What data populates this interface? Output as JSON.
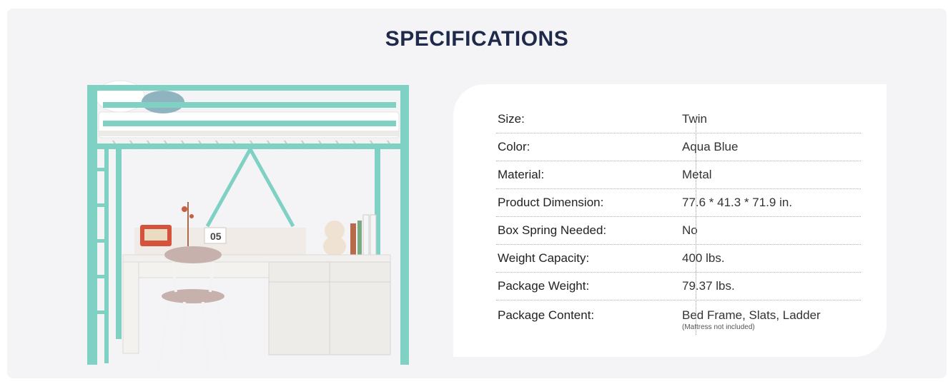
{
  "section": {
    "title": "SPECIFICATIONS"
  },
  "product_image": {
    "icon": "loft-bed-with-desk-illustration",
    "frame_color": "#7fd1c3",
    "calendar_text": "05"
  },
  "specs": [
    {
      "label": "Size:",
      "value": "Twin"
    },
    {
      "label": "Color:",
      "value": "Aqua Blue"
    },
    {
      "label": "Material:",
      "value": "Metal"
    },
    {
      "label": "Product Dimension:",
      "value": "77.6 * 41.3 * 71.9 in."
    },
    {
      "label": "Box Spring Needed:",
      "value": "No"
    },
    {
      "label": "Weight Capacity:",
      "value": "400 lbs."
    },
    {
      "label": "Package Weight:",
      "value": "79.37 lbs."
    },
    {
      "label": "Package Content:",
      "value": "Bed Frame, Slats, Ladder",
      "note": "(Mattress not included)"
    }
  ]
}
